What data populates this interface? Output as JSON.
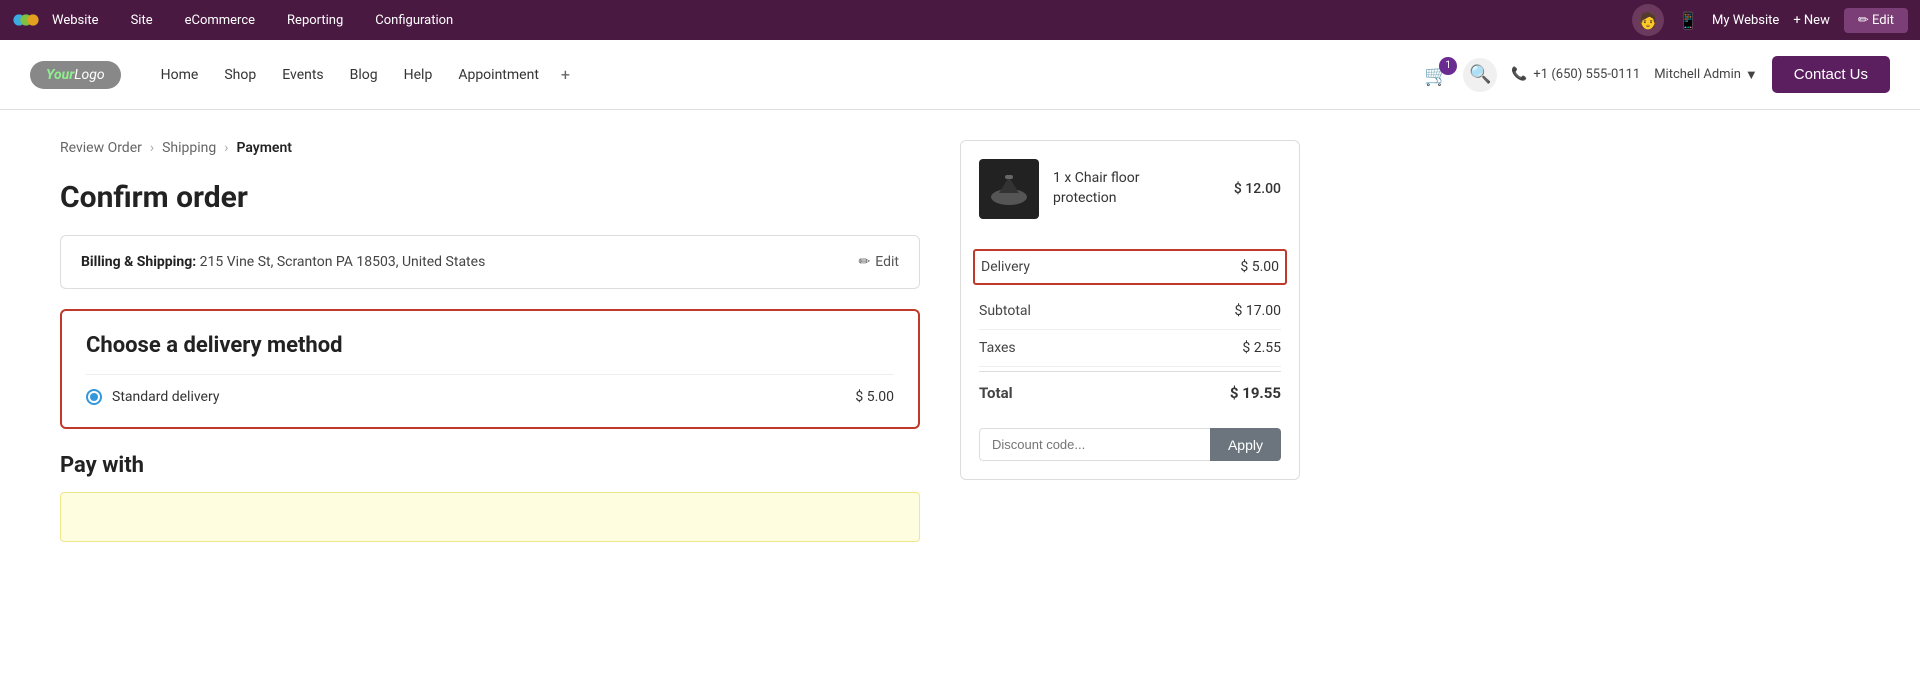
{
  "adminBar": {
    "appName": "Website",
    "navItems": [
      "Site",
      "eCommerce",
      "Reporting",
      "Configuration"
    ],
    "myWebsite": "My Website",
    "newLabel": "+ New",
    "editLabel": "✏ Edit"
  },
  "websiteNav": {
    "logoText": "Your Logo",
    "links": [
      "Home",
      "Shop",
      "Events",
      "Blog",
      "Help",
      "Appointment"
    ],
    "phone": "+1 (650) 555-0111",
    "user": "Mitchell Admin",
    "contactUs": "Contact Us",
    "cartCount": "1"
  },
  "breadcrumb": {
    "step1": "Review Order",
    "step2": "Shipping",
    "step3": "Payment"
  },
  "confirmOrder": {
    "title": "Confirm order",
    "billing": {
      "label": "Billing & Shipping:",
      "address": "215 Vine St, Scranton PA 18503, United States",
      "editLabel": "Edit"
    }
  },
  "delivery": {
    "sectionTitle": "Choose a delivery method",
    "optionLabel": "Standard delivery",
    "optionPrice": "$ 5.00"
  },
  "payWith": {
    "title": "Pay with"
  },
  "orderSummary": {
    "itemQuantity": "1 x Chair floor",
    "itemName": "protection",
    "itemPrice": "$ 12.00",
    "deliveryLabel": "Delivery",
    "deliveryValue": "$ 5.00",
    "subtotalLabel": "Subtotal",
    "subtotalValue": "$ 17.00",
    "taxesLabel": "Taxes",
    "taxesValue": "$ 2.55",
    "totalLabel": "Total",
    "totalValue": "$ 19.55",
    "discountPlaceholder": "Discount code...",
    "applyLabel": "Apply"
  }
}
